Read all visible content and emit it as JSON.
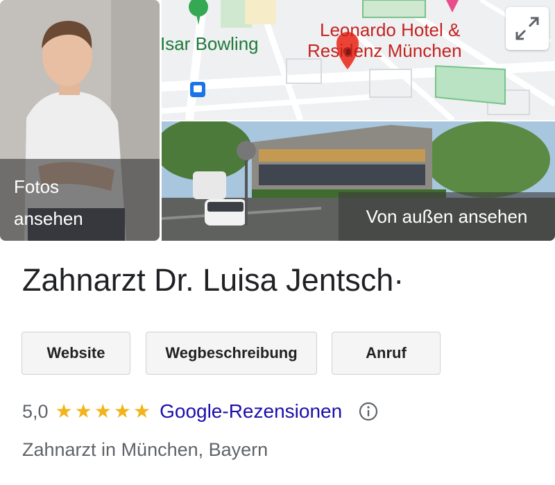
{
  "media": {
    "photos_label_line1": "Fotos",
    "photos_label_line2": "ansehen",
    "street_view_label": "Von außen ansehen",
    "map": {
      "label_bowling": "Isar Bowling",
      "label_hotel_line1": "Leonardo Hotel &",
      "label_hotel_line2": "Residenz München",
      "expand_icon": "expand-icon",
      "pin_color": "#ea4335",
      "poi_green": "#34a853",
      "transit_blue": "#1a73e8"
    }
  },
  "business": {
    "name": "Zahnarzt Dr. Luisa Jentsch·",
    "category": "Zahnarzt in München, Bayern"
  },
  "actions": {
    "website_label": "Website",
    "directions_label": "Wegbeschreibung",
    "call_label": "Anruf"
  },
  "rating": {
    "score": "5,0",
    "stars": 5,
    "reviews_link": "Google-Rezensionen",
    "info_icon": "info-icon",
    "star_color": "#f3b31a"
  }
}
